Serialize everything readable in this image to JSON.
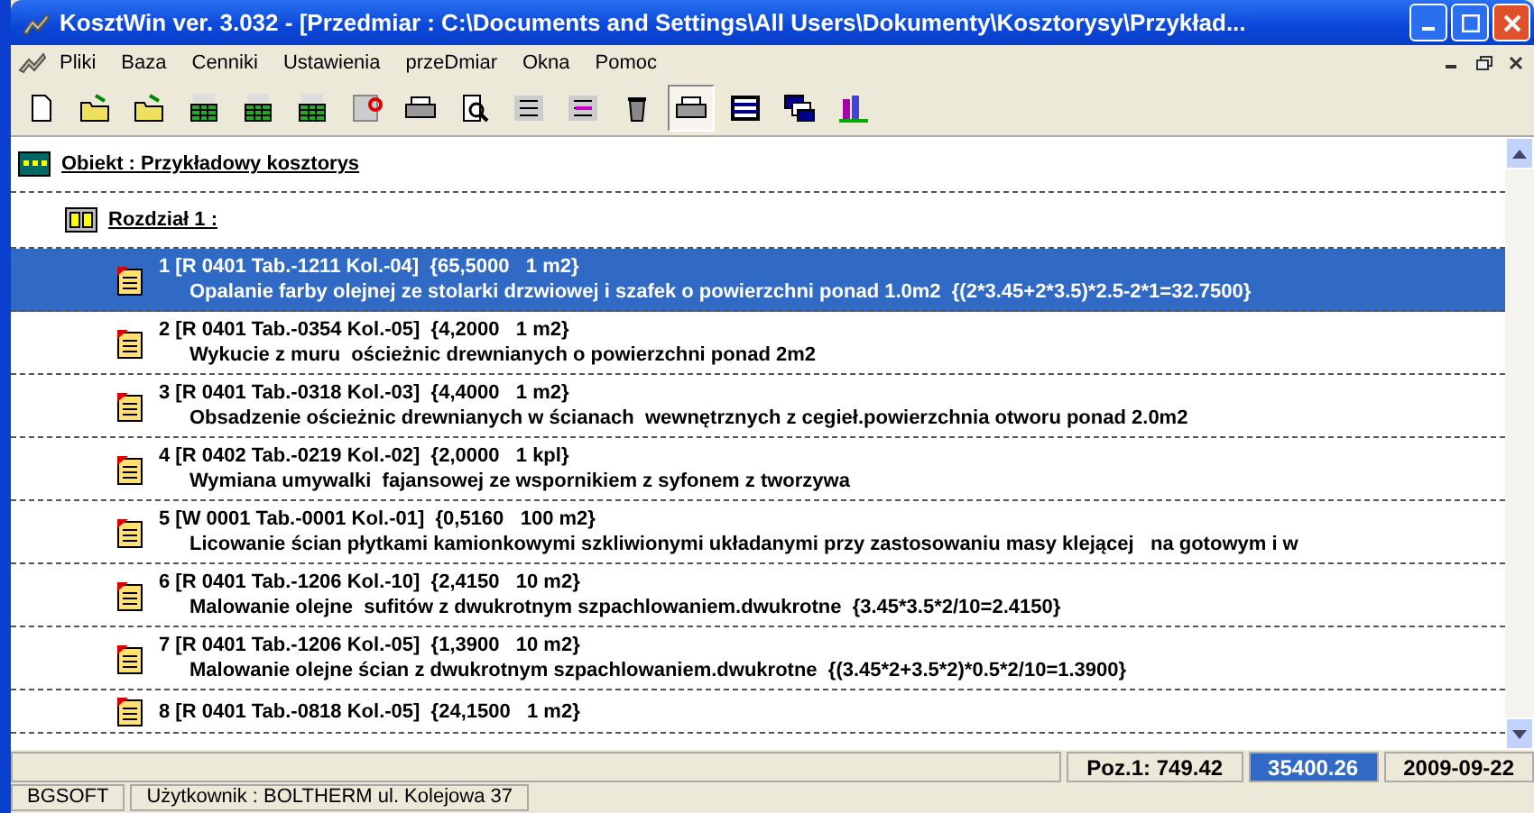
{
  "window": {
    "title": "KosztWin ver. 3.032 - [Przedmiar : C:\\Documents and Settings\\All Users\\Dokumenty\\Kosztorysy\\Przykład..."
  },
  "menu": [
    "Pliki",
    "Baza",
    "Cenniki",
    "Ustawienia",
    "przeDmiar",
    "Okna",
    "Pomoc"
  ],
  "toolbar": [
    {
      "selected": false
    },
    {
      "selected": false
    },
    {
      "selected": false
    },
    {
      "selected": false
    },
    {
      "selected": false
    },
    {
      "selected": false
    },
    {
      "selected": false
    },
    {
      "selected": false
    },
    {
      "selected": false
    },
    {
      "selected": false
    },
    {
      "selected": false
    },
    {
      "selected": false
    },
    {
      "selected": true
    },
    {
      "selected": false
    },
    {
      "selected": false
    },
    {
      "selected": false
    }
  ],
  "tree": {
    "label": "Obiekt : Przykładowy kosztorys",
    "children": [
      {
        "label": "Rozdział 1 :",
        "children": [
          {
            "header": "1 [R 0401 Tab.-1211 Kol.-04]  {65,5000   1 m2}",
            "description": "Opalanie farby olejnej ze stolarki drzwiowej i szafek o powierzchni ponad 1.0m2  {(2*3.45+2*3.5)*2.5-2*1=32.7500}",
            "selected": true
          },
          {
            "header": "2 [R 0401 Tab.-0354 Kol.-05]  {4,2000   1 m2}",
            "description": "Wykucie z muru  ościeżnic drewnianych o powierzchni ponad 2m2",
            "selected": false
          },
          {
            "header": "3 [R 0401 Tab.-0318 Kol.-03]  {4,4000   1 m2}",
            "description": "Obsadzenie ościeżnic drewnianych w ścianach  wewnętrznych z cegieł.powierzchnia otworu ponad 2.0m2",
            "selected": false
          },
          {
            "header": "4 [R 0402 Tab.-0219 Kol.-02]  {2,0000   1 kpl}",
            "description": "Wymiana umywalki  fajansowej ze wspornikiem z syfonem z tworzywa",
            "selected": false
          },
          {
            "header": "5 [W 0001 Tab.-0001 Kol.-01]  {0,5160   100 m2}",
            "description": "Licowanie ścian płytkami kamionkowymi szkliwionymi układanymi przy zastosowaniu masy klejącej   na gotowym i w",
            "selected": false
          },
          {
            "header": "6 [R 0401 Tab.-1206 Kol.-10]  {2,4150   10 m2}",
            "description": "Malowanie olejne  sufitów z dwukrotnym szpachlowaniem.dwukrotne  {3.45*3.5*2/10=2.4150}",
            "selected": false
          },
          {
            "header": "7 [R 0401 Tab.-1206 Kol.-05]  {1,3900   10 m2}",
            "description": "Malowanie olejne ścian z dwukrotnym szpachlowaniem.dwukrotne  {(3.45*2+3.5*2)*0.5*2/10=1.3900}",
            "selected": false
          },
          {
            "header": "8 [R 0401 Tab.-0818 Kol.-05]  {24,1500   1 m2}",
            "selected": false
          }
        ]
      }
    ]
  },
  "status_bar": {
    "position": "Poz.1: 749.42",
    "total": "35400.26",
    "date": "2009-09-22"
  },
  "footer": {
    "company": "BGSOFT",
    "user": "Użytkownik : BOLTHERM ul. Kolejowa 37"
  }
}
